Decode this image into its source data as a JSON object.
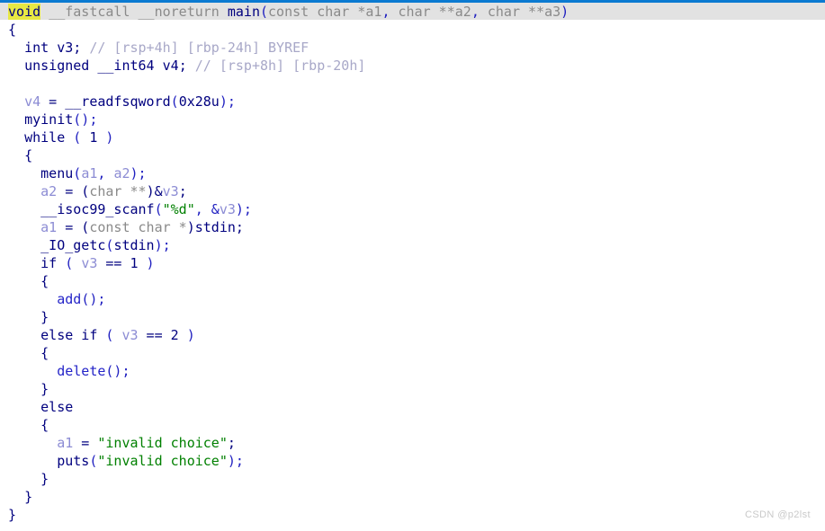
{
  "view": {
    "title": "Pseudocode-A",
    "accent_color": "#0b7ad1",
    "highlight_color": "#e8e843",
    "current_line_color": "#e2e2e2",
    "background_color": "#ffffff",
    "string_color": "#008000",
    "keyword_color": "#00007f",
    "variable_color": "#8c8cd4",
    "comment_color": "#a8a8c8"
  },
  "watermark": {
    "text": "CSDN @p2lst"
  },
  "code": {
    "language": "hexrays-pseudocode",
    "lines": [
      {
        "n": 1,
        "indent": 0,
        "text": "void __fastcall __noreturn main(const char *a1, char **a2, char **a3)",
        "tokens": [
          {
            "t": "void",
            "c": "hl"
          },
          {
            "t": " ",
            "c": "plain"
          },
          {
            "t": "__fastcall __noreturn ",
            "c": "dim"
          },
          {
            "t": "main",
            "c": "fn"
          },
          {
            "t": "(",
            "c": "paren"
          },
          {
            "t": "const char *",
            "c": "dim"
          },
          {
            "t": "a1",
            "c": "dim"
          },
          {
            "t": ", ",
            "c": "paren"
          },
          {
            "t": "char **",
            "c": "dim"
          },
          {
            "t": "a2",
            "c": "dim"
          },
          {
            "t": ", ",
            "c": "paren"
          },
          {
            "t": "char **",
            "c": "dim"
          },
          {
            "t": "a3",
            "c": "dim"
          },
          {
            "t": ")",
            "c": "paren"
          }
        ]
      },
      {
        "n": 2,
        "indent": 0,
        "text": "{",
        "tokens": [
          {
            "t": "{",
            "c": "kw"
          }
        ]
      },
      {
        "n": 3,
        "indent": 1,
        "text": "int v3; // [rsp+4h] [rbp-24h] BYREF",
        "tokens": [
          {
            "t": "int",
            "c": "kw"
          },
          {
            "t": " ",
            "c": "plain"
          },
          {
            "t": "v3",
            "c": "kw"
          },
          {
            "t": "; ",
            "c": "kw"
          },
          {
            "t": "// [rsp+4h] [rbp-24h] BYREF",
            "c": "cmt"
          }
        ]
      },
      {
        "n": 4,
        "indent": 1,
        "text": "unsigned __int64 v4; // [rsp+8h] [rbp-20h]",
        "tokens": [
          {
            "t": "unsigned __int64",
            "c": "kw"
          },
          {
            "t": " ",
            "c": "plain"
          },
          {
            "t": "v4",
            "c": "kw"
          },
          {
            "t": "; ",
            "c": "kw"
          },
          {
            "t": "// [rsp+8h] [rbp-20h]",
            "c": "cmt"
          }
        ]
      },
      {
        "n": 5,
        "indent": 0,
        "text": "",
        "tokens": []
      },
      {
        "n": 6,
        "indent": 1,
        "text": "v4 = __readfsqword(0x28u);",
        "tokens": [
          {
            "t": "v4",
            "c": "var"
          },
          {
            "t": " = ",
            "c": "kw"
          },
          {
            "t": "__readfsqword",
            "c": "kw"
          },
          {
            "t": "(",
            "c": "paren"
          },
          {
            "t": "0x28u",
            "c": "kw"
          },
          {
            "t": ");",
            "c": "paren"
          }
        ]
      },
      {
        "n": 7,
        "indent": 1,
        "text": "myinit();",
        "tokens": [
          {
            "t": "myinit",
            "c": "fn"
          },
          {
            "t": "();",
            "c": "paren"
          }
        ]
      },
      {
        "n": 8,
        "indent": 1,
        "text": "while ( 1 )",
        "tokens": [
          {
            "t": "while",
            "c": "kw"
          },
          {
            "t": " ( ",
            "c": "paren"
          },
          {
            "t": "1",
            "c": "num"
          },
          {
            "t": " )",
            "c": "paren"
          }
        ]
      },
      {
        "n": 9,
        "indent": 1,
        "text": "{",
        "tokens": [
          {
            "t": "{",
            "c": "kw"
          }
        ]
      },
      {
        "n": 10,
        "indent": 2,
        "text": "menu(a1, a2);",
        "tokens": [
          {
            "t": "menu",
            "c": "fn"
          },
          {
            "t": "(",
            "c": "paren"
          },
          {
            "t": "a1",
            "c": "var"
          },
          {
            "t": ", ",
            "c": "paren"
          },
          {
            "t": "a2",
            "c": "var"
          },
          {
            "t": ");",
            "c": "paren"
          }
        ]
      },
      {
        "n": 11,
        "indent": 2,
        "text": "a2 = (char **)&v3;",
        "tokens": [
          {
            "t": "a2",
            "c": "var"
          },
          {
            "t": " = (",
            "c": "kw"
          },
          {
            "t": "char **",
            "c": "dim"
          },
          {
            "t": ")&",
            "c": "kw"
          },
          {
            "t": "v3",
            "c": "var"
          },
          {
            "t": ";",
            "c": "kw"
          }
        ]
      },
      {
        "n": 12,
        "indent": 2,
        "text": "__isoc99_scanf(\"%d\", &v3);",
        "tokens": [
          {
            "t": "__isoc99_scanf",
            "c": "fn"
          },
          {
            "t": "(",
            "c": "paren"
          },
          {
            "t": "\"%d\"",
            "c": "str"
          },
          {
            "t": ", &",
            "c": "paren"
          },
          {
            "t": "v3",
            "c": "var"
          },
          {
            "t": ");",
            "c": "paren"
          }
        ]
      },
      {
        "n": 13,
        "indent": 2,
        "text": "a1 = (const char *)stdin;",
        "tokens": [
          {
            "t": "a1",
            "c": "var"
          },
          {
            "t": " = (",
            "c": "kw"
          },
          {
            "t": "const char *",
            "c": "dim"
          },
          {
            "t": ")",
            "c": "kw"
          },
          {
            "t": "stdin",
            "c": "kw"
          },
          {
            "t": ";",
            "c": "kw"
          }
        ]
      },
      {
        "n": 14,
        "indent": 2,
        "text": "_IO_getc(stdin);",
        "tokens": [
          {
            "t": "_IO_getc",
            "c": "fn"
          },
          {
            "t": "(",
            "c": "paren"
          },
          {
            "t": "stdin",
            "c": "kw"
          },
          {
            "t": ");",
            "c": "paren"
          }
        ]
      },
      {
        "n": 15,
        "indent": 2,
        "text": "if ( v3 == 1 )",
        "tokens": [
          {
            "t": "if",
            "c": "kw"
          },
          {
            "t": " ( ",
            "c": "paren"
          },
          {
            "t": "v3",
            "c": "var"
          },
          {
            "t": " == ",
            "c": "kw"
          },
          {
            "t": "1",
            "c": "num"
          },
          {
            "t": " )",
            "c": "paren"
          }
        ]
      },
      {
        "n": 16,
        "indent": 2,
        "text": "{",
        "tokens": [
          {
            "t": "{",
            "c": "kw"
          }
        ]
      },
      {
        "n": 17,
        "indent": 3,
        "text": "add();",
        "tokens": [
          {
            "t": "add",
            "c": "fnblue"
          },
          {
            "t": "();",
            "c": "paren"
          }
        ]
      },
      {
        "n": 18,
        "indent": 2,
        "text": "}",
        "tokens": [
          {
            "t": "}",
            "c": "kw"
          }
        ]
      },
      {
        "n": 19,
        "indent": 2,
        "text": "else if ( v3 == 2 )",
        "tokens": [
          {
            "t": "else if",
            "c": "kw"
          },
          {
            "t": " ( ",
            "c": "paren"
          },
          {
            "t": "v3",
            "c": "var"
          },
          {
            "t": " == ",
            "c": "kw"
          },
          {
            "t": "2",
            "c": "num"
          },
          {
            "t": " )",
            "c": "paren"
          }
        ]
      },
      {
        "n": 20,
        "indent": 2,
        "text": "{",
        "tokens": [
          {
            "t": "{",
            "c": "kw"
          }
        ]
      },
      {
        "n": 21,
        "indent": 3,
        "text": "delete();",
        "tokens": [
          {
            "t": "delete",
            "c": "fnblue"
          },
          {
            "t": "();",
            "c": "paren"
          }
        ]
      },
      {
        "n": 22,
        "indent": 2,
        "text": "}",
        "tokens": [
          {
            "t": "}",
            "c": "kw"
          }
        ]
      },
      {
        "n": 23,
        "indent": 2,
        "text": "else",
        "tokens": [
          {
            "t": "else",
            "c": "kw"
          }
        ]
      },
      {
        "n": 24,
        "indent": 2,
        "text": "{",
        "tokens": [
          {
            "t": "{",
            "c": "kw"
          }
        ]
      },
      {
        "n": 25,
        "indent": 3,
        "text": "a1 = \"invalid choice\";",
        "tokens": [
          {
            "t": "a1",
            "c": "var"
          },
          {
            "t": " = ",
            "c": "kw"
          },
          {
            "t": "\"invalid choice\"",
            "c": "str"
          },
          {
            "t": ";",
            "c": "kw"
          }
        ]
      },
      {
        "n": 26,
        "indent": 3,
        "text": "puts(\"invalid choice\");",
        "tokens": [
          {
            "t": "puts",
            "c": "fn"
          },
          {
            "t": "(",
            "c": "paren"
          },
          {
            "t": "\"invalid choice\"",
            "c": "str"
          },
          {
            "t": ");",
            "c": "paren"
          }
        ]
      },
      {
        "n": 27,
        "indent": 2,
        "text": "}",
        "tokens": [
          {
            "t": "}",
            "c": "kw"
          }
        ]
      },
      {
        "n": 28,
        "indent": 1,
        "text": "}",
        "tokens": [
          {
            "t": "}",
            "c": "kw"
          }
        ]
      },
      {
        "n": 29,
        "indent": 0,
        "text": "}",
        "tokens": [
          {
            "t": "}",
            "c": "kw"
          }
        ]
      }
    ]
  }
}
